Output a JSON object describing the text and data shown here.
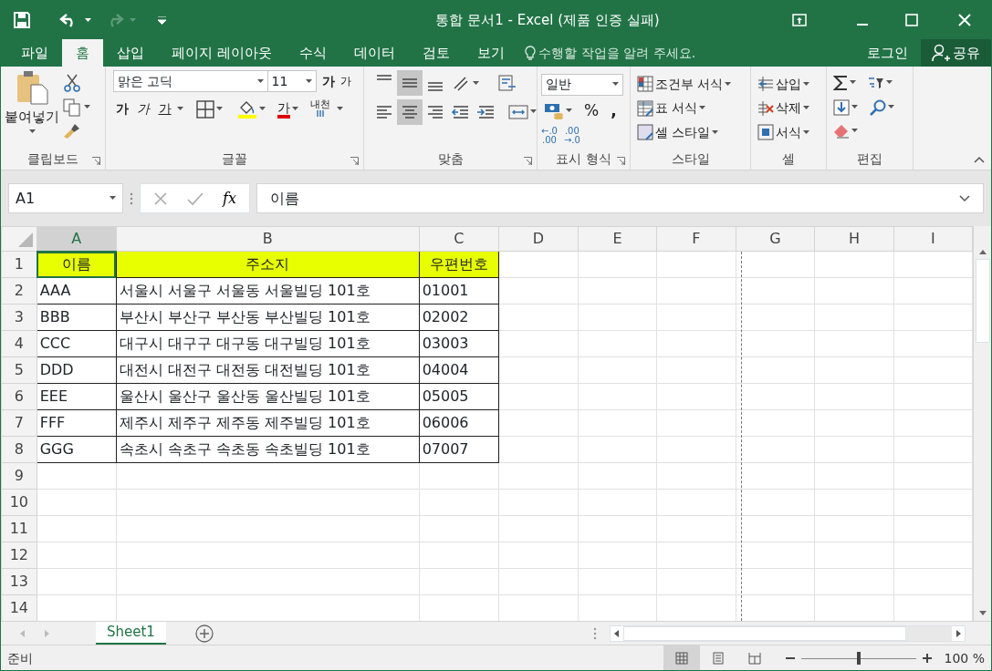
{
  "window": {
    "title": "통합 문서1 - Excel (제품 인증 실패)"
  },
  "tabs": [
    {
      "label": "파일",
      "selected": false
    },
    {
      "label": "홈",
      "selected": true
    },
    {
      "label": "삽입",
      "selected": false
    },
    {
      "label": "페이지 레이아웃",
      "selected": false
    },
    {
      "label": "수식",
      "selected": false
    },
    {
      "label": "데이터",
      "selected": false
    },
    {
      "label": "검토",
      "selected": false
    },
    {
      "label": "보기",
      "selected": false
    }
  ],
  "tell_me": {
    "placeholder": "수행할 작업을 알려 주세요."
  },
  "account": {
    "login": "로그인",
    "share": "공유"
  },
  "ribbon": {
    "clipboard": {
      "paste": "붙여넣기",
      "label": "클립보드",
      "launcher": true
    },
    "font": {
      "name": "맑은 고딕",
      "size": "11",
      "grow": "가",
      "shrink": "가",
      "bold": "가",
      "italic": "가",
      "underline": "가",
      "font_color": "가",
      "phonetic": "내천",
      "label": "글꼴",
      "launcher": true
    },
    "alignment": {
      "buttons": [
        {
          "kind": "top",
          "selected": false
        },
        {
          "kind": "middle",
          "selected": true
        },
        {
          "kind": "bottom",
          "selected": false
        },
        {
          "kind": "orient",
          "selected": false
        },
        {
          "kind": "left",
          "selected": false
        },
        {
          "kind": "center",
          "selected": true
        },
        {
          "kind": "right",
          "selected": false
        },
        {
          "kind": "outdent",
          "selected": false
        },
        {
          "kind": "indent",
          "selected": false
        }
      ],
      "label": "맞춤",
      "launcher": true
    },
    "number": {
      "format": "일반",
      "percent": "%",
      "comma": ",",
      "increase_decimal": [
        "←.0",
        ".00"
      ],
      "decrease_decimal": [
        ".00",
        "→.0"
      ],
      "label": "표시 형식",
      "launcher": true
    },
    "styles": {
      "items": [
        "조건부 서식",
        "표 서식",
        "셀 스타일"
      ],
      "label": "스타일",
      "launcher": false
    },
    "cells": {
      "items": [
        "삽입",
        "삭제",
        "서식"
      ],
      "label": "셀",
      "launcher": false
    },
    "editing": {
      "label": "편집",
      "launcher": false
    }
  },
  "formula_bar": {
    "name_box": "A1",
    "fx": "fx",
    "value": "이름"
  },
  "sheet": {
    "columns": [
      {
        "label": "A",
        "selected": true,
        "page_break": false
      },
      {
        "label": "B",
        "selected": false,
        "page_break": false
      },
      {
        "label": "C",
        "selected": false,
        "page_break": false
      },
      {
        "label": "D",
        "selected": false,
        "page_break": false
      },
      {
        "label": "E",
        "selected": false,
        "page_break": false
      },
      {
        "label": "F",
        "selected": false,
        "page_break": true
      },
      {
        "label": "G",
        "selected": false,
        "page_break": false
      },
      {
        "label": "H",
        "selected": false,
        "page_break": false
      },
      {
        "label": "I",
        "selected": false,
        "page_break": false
      }
    ],
    "rows": [
      {
        "label": "1",
        "kind": "header",
        "cells": [
          {
            "text": "이름",
            "selected": true
          },
          {
            "text": "주소지",
            "selected": false
          },
          {
            "text": "우편번호",
            "selected": false
          }
        ]
      },
      {
        "label": "2",
        "kind": "data",
        "cells": [
          {
            "text": "AAA",
            "selected": false
          },
          {
            "text": "서울시 서울구 서울동 서울빌딩 101호",
            "selected": false
          },
          {
            "text": "01001",
            "selected": false
          }
        ]
      },
      {
        "label": "3",
        "kind": "data",
        "cells": [
          {
            "text": "BBB",
            "selected": false
          },
          {
            "text": "부산시 부산구 부산동 부산빌딩 101호",
            "selected": false
          },
          {
            "text": "02002",
            "selected": false
          }
        ]
      },
      {
        "label": "4",
        "kind": "data",
        "cells": [
          {
            "text": "CCC",
            "selected": false
          },
          {
            "text": "대구시 대구구 대구동 대구빌딩 101호",
            "selected": false
          },
          {
            "text": "03003",
            "selected": false
          }
        ]
      },
      {
        "label": "5",
        "kind": "data",
        "cells": [
          {
            "text": "DDD",
            "selected": false
          },
          {
            "text": "대전시 대전구 대전동 대전빌딩 101호",
            "selected": false
          },
          {
            "text": "04004",
            "selected": false
          }
        ]
      },
      {
        "label": "6",
        "kind": "data",
        "cells": [
          {
            "text": "EEE",
            "selected": false
          },
          {
            "text": "울산시 울산구 울산동 울산빌딩 101호",
            "selected": false
          },
          {
            "text": "05005",
            "selected": false
          }
        ]
      },
      {
        "label": "7",
        "kind": "data",
        "cells": [
          {
            "text": "FFF",
            "selected": false
          },
          {
            "text": "제주시 제주구 제주동 제주빌딩 101호",
            "selected": false
          },
          {
            "text": "06006",
            "selected": false
          }
        ]
      },
      {
        "label": "8",
        "kind": "data",
        "cells": [
          {
            "text": "GGG",
            "selected": false
          },
          {
            "text": "속초시 속초구 속초동 속초빌딩 101호",
            "selected": false
          },
          {
            "text": "07007",
            "selected": false
          }
        ]
      },
      {
        "label": "9",
        "kind": "empty"
      },
      {
        "label": "10",
        "kind": "empty"
      },
      {
        "label": "11",
        "kind": "empty"
      },
      {
        "label": "12",
        "kind": "empty"
      },
      {
        "label": "13",
        "kind": "empty"
      },
      {
        "label": "14",
        "kind": "empty"
      }
    ]
  },
  "sheet_tabs": [
    {
      "label": "Sheet1",
      "selected": true
    }
  ],
  "status_bar": {
    "text": "준비",
    "views": [
      {
        "kind": "normal",
        "selected": true
      },
      {
        "kind": "page_layout",
        "selected": false
      },
      {
        "kind": "page_break",
        "selected": false
      }
    ],
    "zoom": {
      "level": 0.5,
      "reading": "100 %"
    }
  }
}
